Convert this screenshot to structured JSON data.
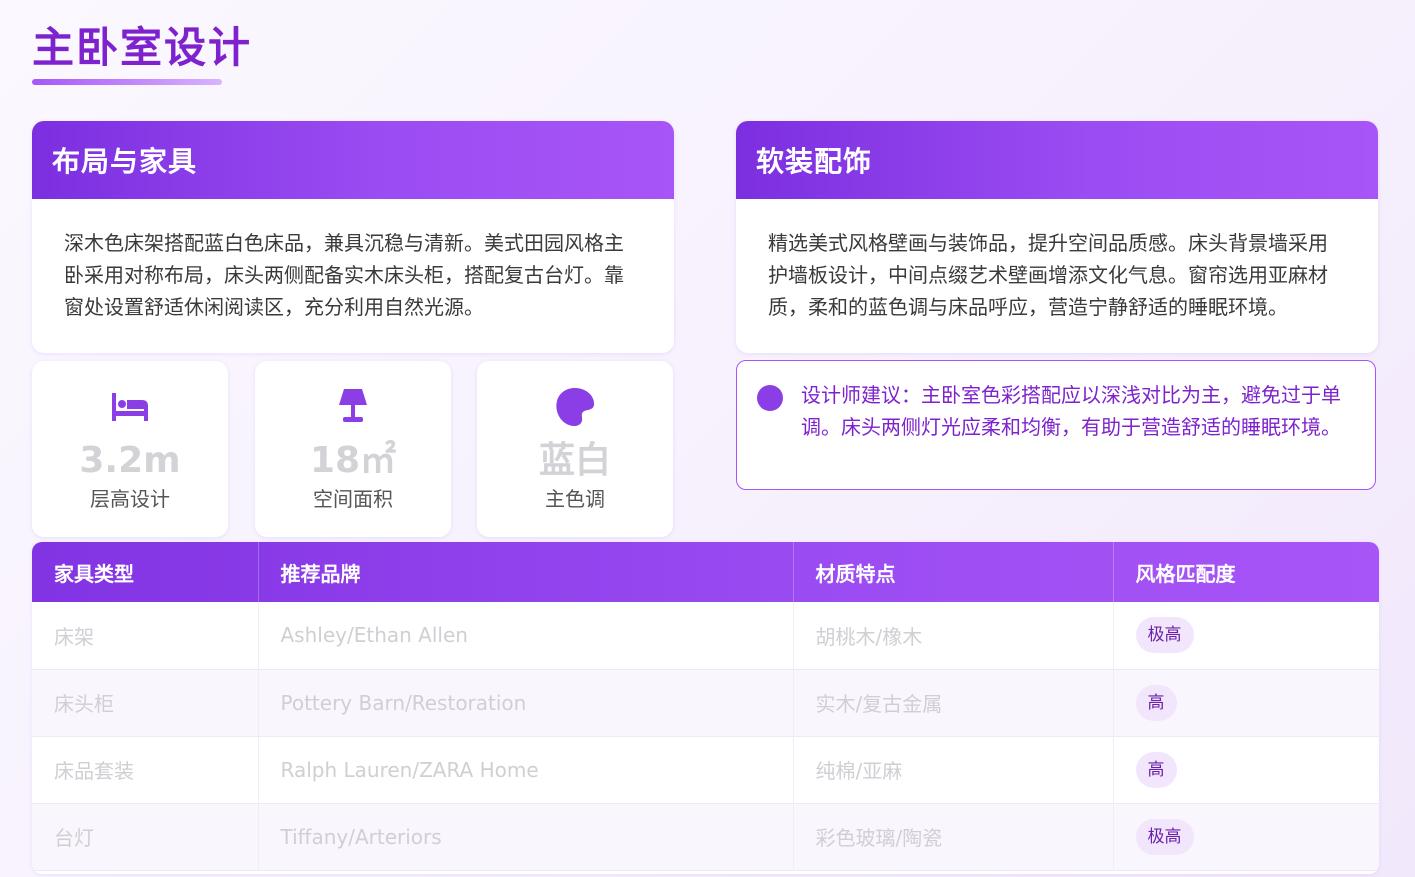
{
  "page": {
    "title": "主卧室设计"
  },
  "layout_card": {
    "title": "布局与家具",
    "body": "深木色床架搭配蓝白色床品，兼具沉稳与清新。美式田园风格主卧采用对称布局，床头两侧配备实木床头柜，搭配复古台灯。靠窗处设置舒适休闲阅读区，充分利用自然光源。"
  },
  "decor_card": {
    "title": "软装配饰",
    "body": "精选美式风格壁画与装饰品，提升空间品质感。床头背景墙采用护墙板设计，中间点缀艺术壁画增添文化气息。窗帘选用亚麻材质，柔和的蓝色调与床品呼应，营造宁静舒适的睡眠环境。"
  },
  "stats": [
    {
      "icon": "bed-icon",
      "value": "3.2m",
      "label": "层高设计"
    },
    {
      "icon": "lamp-icon",
      "value": "18㎡",
      "label": "空间面积"
    },
    {
      "icon": "palette-icon",
      "value": "蓝白",
      "label": "主色调"
    }
  ],
  "advice": {
    "text": "设计师建议：主卧室色彩搭配应以深浅对比为主，避免过于单调。床头两侧灯光应柔和均衡，有助于营造舒适的睡眠环境。"
  },
  "table": {
    "headers": [
      "家具类型",
      "推荐品牌",
      "材质特点",
      "风格匹配度"
    ],
    "rows": [
      [
        "床架",
        "Ashley/Ethan Allen",
        "胡桃木/橡木",
        "极高"
      ],
      [
        "床头柜",
        "Pottery Barn/Restoration",
        "实木/复古金属",
        "高"
      ],
      [
        "床品套装",
        "Ralph Lauren/ZARA Home",
        "纯棉/亚麻",
        "高"
      ],
      [
        "台灯",
        "Tiffany/Arteriors",
        "彩色玻璃/陶瓷",
        "极高"
      ]
    ]
  },
  "colors": {
    "accent": "#7e22ce",
    "header_gradient_start": "#7c2fe0",
    "header_gradient_end": "#a855f7",
    "badge_bg": "#f1e6fc"
  }
}
